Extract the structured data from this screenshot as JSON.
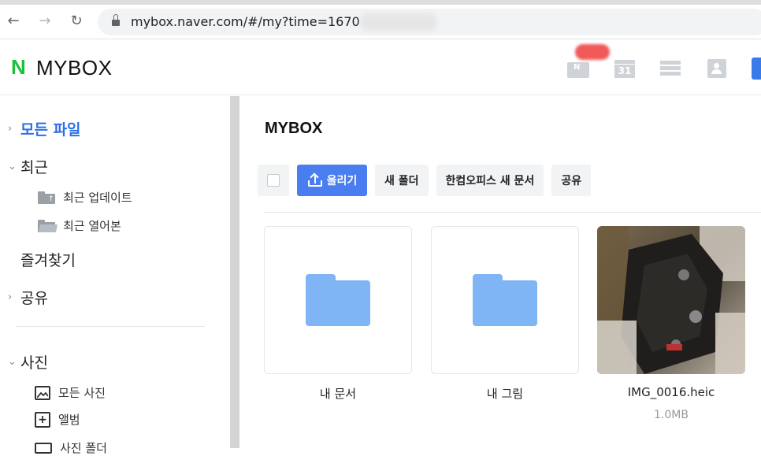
{
  "browser": {
    "url": "mybox.naver.com/#/my?time=1670"
  },
  "header": {
    "logo_mark": "N",
    "logo_text": "MYBOX",
    "calendar_day": "31",
    "mail_mark": "N"
  },
  "sidebar": {
    "all_files": "모든 파일",
    "recent": "최근",
    "recent_updates": "최근 업데이트",
    "recent_opened": "최근 열어본",
    "favorites": "즐겨찾기",
    "shared": "공유",
    "photos": "사진",
    "all_photos": "모든 사진",
    "albums": "앨범",
    "photo_folders": "사진 폴더"
  },
  "main": {
    "title": "MYBOX",
    "toolbar": {
      "upload": "올리기",
      "new_folder": "새 폴더",
      "hancom_new_doc": "한컴오피스 새 문서",
      "share": "공유"
    },
    "items": [
      {
        "name": "내 문서",
        "type": "folder"
      },
      {
        "name": "내 그림",
        "type": "folder"
      },
      {
        "name": "IMG_0016.heic",
        "type": "image",
        "size": "1.0MB"
      }
    ]
  },
  "colors": {
    "accent": "#4a7ef0",
    "active_text": "#2c6fea",
    "logo_green": "#19c23a",
    "folder_blue": "#7fb4f5"
  },
  "icons": {
    "back": "back-arrow-icon",
    "forward": "forward-arrow-icon",
    "reload": "reload-icon",
    "lock": "lock-icon",
    "upload": "upload-icon",
    "folder": "folder-icon"
  }
}
